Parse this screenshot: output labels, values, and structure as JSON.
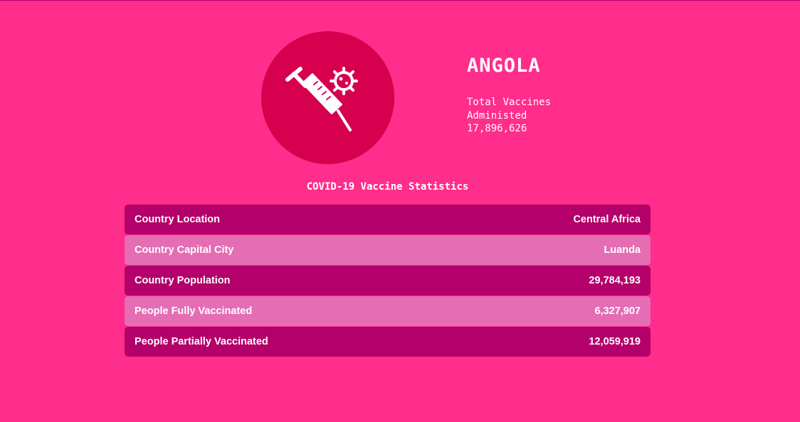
{
  "header": {
    "country": "ANGOLA",
    "total_label_line1": "Total Vaccines",
    "total_label_line2": "Administed",
    "total_value": "17,896,626"
  },
  "logo": {
    "icons": [
      "syringe-icon",
      "virus-icon"
    ],
    "circle_color": "#d6004e"
  },
  "section": {
    "title": "COVID-19 Vaccine Statistics"
  },
  "stats": [
    {
      "label": "Country Location",
      "value": "Central Africa"
    },
    {
      "label": "Country Capital City",
      "value": "Luanda"
    },
    {
      "label": "Country Population",
      "value": "29,784,193"
    },
    {
      "label": "People Fully Vaccinated",
      "value": "6,327,907"
    },
    {
      "label": "People Partially Vaccinated",
      "value": "12,059,919"
    }
  ],
  "colors": {
    "background": "#ff2d8b",
    "row_dark": "#b3006a",
    "row_light": "#e46db4"
  }
}
